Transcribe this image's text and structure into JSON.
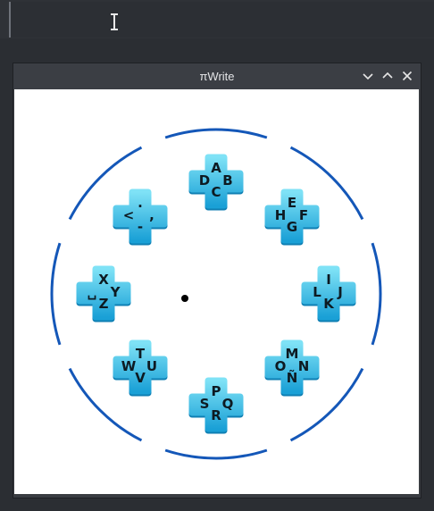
{
  "window": {
    "title": "πWrite"
  },
  "center_marker": "dot-icon",
  "colors": {
    "ring": "#1457b8",
    "key_top": "#7fe2f6",
    "key_bottom": "#1aa0d6",
    "key_text": "#0d1a22"
  },
  "groups": [
    {
      "name": "group-abcd",
      "top": "A",
      "left": "D",
      "right": "B",
      "bottom": "C"
    },
    {
      "name": "group-efgh",
      "top": "E",
      "left": "H",
      "right": "F",
      "bottom": "G"
    },
    {
      "name": "group-ijkl",
      "top": "I",
      "left": "L",
      "right": "J",
      "bottom": "K"
    },
    {
      "name": "group-mnno",
      "top": "M",
      "left": "O",
      "right": "N",
      "bottom": "Ñ"
    },
    {
      "name": "group-pqrs",
      "top": "P",
      "left": "S",
      "right": "Q",
      "bottom": "R"
    },
    {
      "name": "group-tuvw",
      "top": "T",
      "left": "W",
      "right": "U",
      "bottom": "V"
    },
    {
      "name": "group-xyz-space",
      "top": "X",
      "left": "␣",
      "right": "Y",
      "bottom": "Z"
    },
    {
      "name": "group-punctuation",
      "top": ".",
      "left": "<",
      "right": ",",
      "bottom": "-"
    }
  ]
}
